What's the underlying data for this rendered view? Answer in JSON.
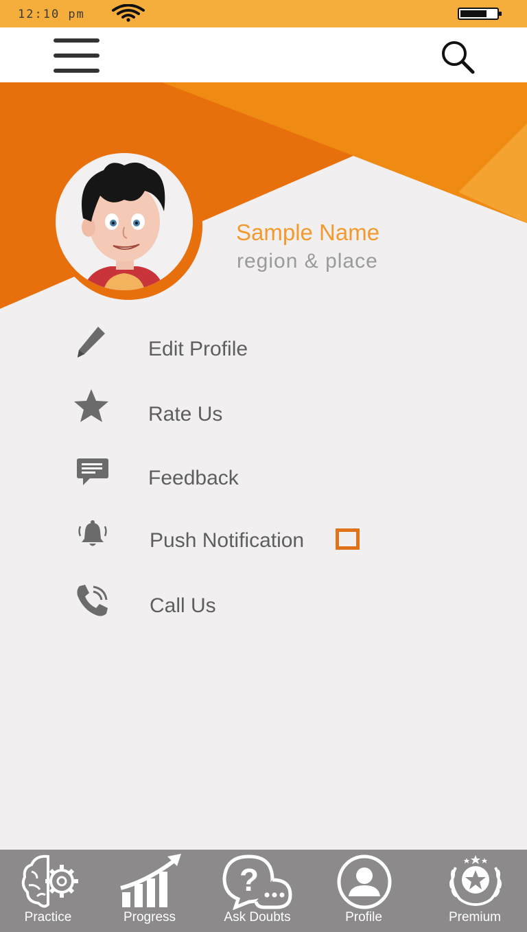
{
  "status_bar": {
    "time": "12:10 pm"
  },
  "header": {
    "menu_icon": "hamburger-icon",
    "search_icon": "search-icon"
  },
  "profile": {
    "name": "Sample Name",
    "location": "region & place",
    "avatar": "cartoon-boy-avatar"
  },
  "menu": [
    {
      "label": "Edit Profile",
      "icon": "pencil-icon"
    },
    {
      "label": "Rate Us",
      "icon": "star-icon"
    },
    {
      "label": "Feedback",
      "icon": "chat-icon"
    },
    {
      "label": "Push Notification",
      "icon": "bell-icon",
      "toggle": false
    },
    {
      "label": "Call Us",
      "icon": "phone-icon"
    }
  ],
  "bottom_nav": [
    {
      "label": "Practice",
      "icon": "brain-gear-icon"
    },
    {
      "label": "Progress",
      "icon": "growth-chart-icon"
    },
    {
      "label": "Ask Doubts",
      "icon": "question-chat-icon"
    },
    {
      "label": "Profile",
      "icon": "user-icon"
    },
    {
      "label": "Premium",
      "icon": "laurel-star-icon"
    }
  ],
  "colors": {
    "status_bar": "#f5ad3b",
    "accent_dark": "#e8700c",
    "accent_light": "#ef8a12",
    "name_color": "#f19a2d",
    "nav_bg": "#8c8a8b",
    "text": "#5e5e5e"
  }
}
